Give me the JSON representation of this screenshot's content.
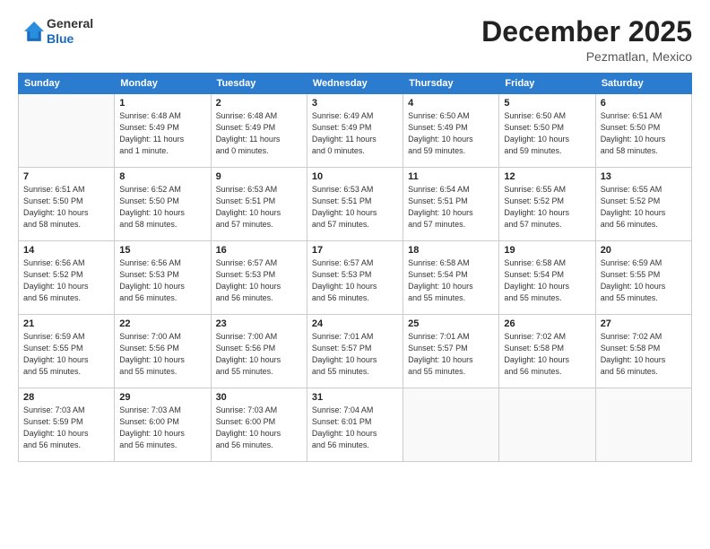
{
  "logo": {
    "general": "General",
    "blue": "Blue"
  },
  "title": "December 2025",
  "subtitle": "Pezmatlan, Mexico",
  "days_header": [
    "Sunday",
    "Monday",
    "Tuesday",
    "Wednesday",
    "Thursday",
    "Friday",
    "Saturday"
  ],
  "weeks": [
    [
      {
        "num": "",
        "info": ""
      },
      {
        "num": "1",
        "info": "Sunrise: 6:48 AM\nSunset: 5:49 PM\nDaylight: 11 hours\nand 1 minute."
      },
      {
        "num": "2",
        "info": "Sunrise: 6:48 AM\nSunset: 5:49 PM\nDaylight: 11 hours\nand 0 minutes."
      },
      {
        "num": "3",
        "info": "Sunrise: 6:49 AM\nSunset: 5:49 PM\nDaylight: 11 hours\nand 0 minutes."
      },
      {
        "num": "4",
        "info": "Sunrise: 6:50 AM\nSunset: 5:49 PM\nDaylight: 10 hours\nand 59 minutes."
      },
      {
        "num": "5",
        "info": "Sunrise: 6:50 AM\nSunset: 5:50 PM\nDaylight: 10 hours\nand 59 minutes."
      },
      {
        "num": "6",
        "info": "Sunrise: 6:51 AM\nSunset: 5:50 PM\nDaylight: 10 hours\nand 58 minutes."
      }
    ],
    [
      {
        "num": "7",
        "info": "Sunrise: 6:51 AM\nSunset: 5:50 PM\nDaylight: 10 hours\nand 58 minutes."
      },
      {
        "num": "8",
        "info": "Sunrise: 6:52 AM\nSunset: 5:50 PM\nDaylight: 10 hours\nand 58 minutes."
      },
      {
        "num": "9",
        "info": "Sunrise: 6:53 AM\nSunset: 5:51 PM\nDaylight: 10 hours\nand 57 minutes."
      },
      {
        "num": "10",
        "info": "Sunrise: 6:53 AM\nSunset: 5:51 PM\nDaylight: 10 hours\nand 57 minutes."
      },
      {
        "num": "11",
        "info": "Sunrise: 6:54 AM\nSunset: 5:51 PM\nDaylight: 10 hours\nand 57 minutes."
      },
      {
        "num": "12",
        "info": "Sunrise: 6:55 AM\nSunset: 5:52 PM\nDaylight: 10 hours\nand 57 minutes."
      },
      {
        "num": "13",
        "info": "Sunrise: 6:55 AM\nSunset: 5:52 PM\nDaylight: 10 hours\nand 56 minutes."
      }
    ],
    [
      {
        "num": "14",
        "info": "Sunrise: 6:56 AM\nSunset: 5:52 PM\nDaylight: 10 hours\nand 56 minutes."
      },
      {
        "num": "15",
        "info": "Sunrise: 6:56 AM\nSunset: 5:53 PM\nDaylight: 10 hours\nand 56 minutes."
      },
      {
        "num": "16",
        "info": "Sunrise: 6:57 AM\nSunset: 5:53 PM\nDaylight: 10 hours\nand 56 minutes."
      },
      {
        "num": "17",
        "info": "Sunrise: 6:57 AM\nSunset: 5:53 PM\nDaylight: 10 hours\nand 56 minutes."
      },
      {
        "num": "18",
        "info": "Sunrise: 6:58 AM\nSunset: 5:54 PM\nDaylight: 10 hours\nand 55 minutes."
      },
      {
        "num": "19",
        "info": "Sunrise: 6:58 AM\nSunset: 5:54 PM\nDaylight: 10 hours\nand 55 minutes."
      },
      {
        "num": "20",
        "info": "Sunrise: 6:59 AM\nSunset: 5:55 PM\nDaylight: 10 hours\nand 55 minutes."
      }
    ],
    [
      {
        "num": "21",
        "info": "Sunrise: 6:59 AM\nSunset: 5:55 PM\nDaylight: 10 hours\nand 55 minutes."
      },
      {
        "num": "22",
        "info": "Sunrise: 7:00 AM\nSunset: 5:56 PM\nDaylight: 10 hours\nand 55 minutes."
      },
      {
        "num": "23",
        "info": "Sunrise: 7:00 AM\nSunset: 5:56 PM\nDaylight: 10 hours\nand 55 minutes."
      },
      {
        "num": "24",
        "info": "Sunrise: 7:01 AM\nSunset: 5:57 PM\nDaylight: 10 hours\nand 55 minutes."
      },
      {
        "num": "25",
        "info": "Sunrise: 7:01 AM\nSunset: 5:57 PM\nDaylight: 10 hours\nand 55 minutes."
      },
      {
        "num": "26",
        "info": "Sunrise: 7:02 AM\nSunset: 5:58 PM\nDaylight: 10 hours\nand 56 minutes."
      },
      {
        "num": "27",
        "info": "Sunrise: 7:02 AM\nSunset: 5:58 PM\nDaylight: 10 hours\nand 56 minutes."
      }
    ],
    [
      {
        "num": "28",
        "info": "Sunrise: 7:03 AM\nSunset: 5:59 PM\nDaylight: 10 hours\nand 56 minutes."
      },
      {
        "num": "29",
        "info": "Sunrise: 7:03 AM\nSunset: 6:00 PM\nDaylight: 10 hours\nand 56 minutes."
      },
      {
        "num": "30",
        "info": "Sunrise: 7:03 AM\nSunset: 6:00 PM\nDaylight: 10 hours\nand 56 minutes."
      },
      {
        "num": "31",
        "info": "Sunrise: 7:04 AM\nSunset: 6:01 PM\nDaylight: 10 hours\nand 56 minutes."
      },
      {
        "num": "",
        "info": ""
      },
      {
        "num": "",
        "info": ""
      },
      {
        "num": "",
        "info": ""
      }
    ]
  ]
}
